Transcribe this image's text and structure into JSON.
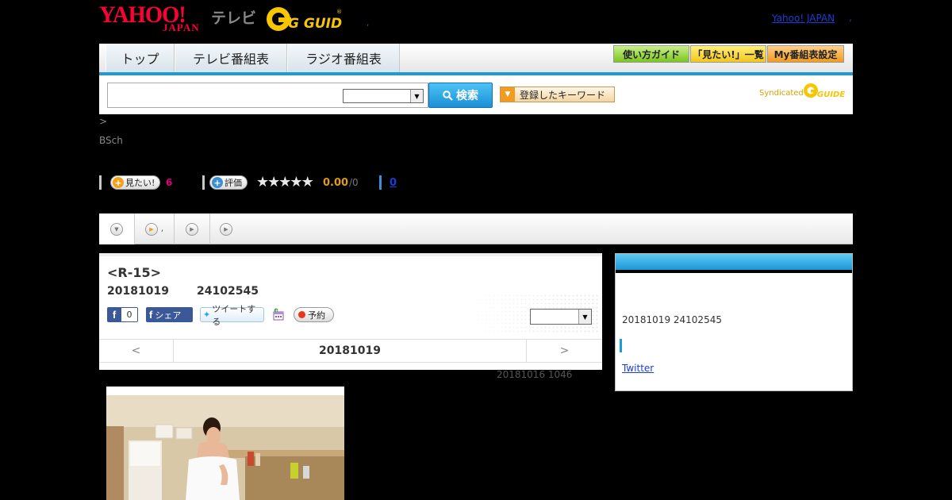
{
  "header": {
    "yahoo_logo": "YAHOO!",
    "yahoo_japan": "JAPAN",
    "tv_label": "テレビ",
    "gguide_logo": "G GUIDE",
    "yahoo_japan_link": "Yahoo! JAPAN",
    "link_separator": ",",
    "logo_dot": ","
  },
  "nav": {
    "tabs": [
      "トップ",
      "テレビ番組表",
      "ラジオ番組表"
    ],
    "buttons": [
      "使い方ガイド",
      "「見たい!」一覧",
      "My番組表設定"
    ],
    "accent": "#1e9ad6"
  },
  "search": {
    "input_value": "",
    "select_value": "",
    "search_label": "検索",
    "keyword_label": "登録したキーワード",
    "syndicated": "Syndicated"
  },
  "breadcrumb": ">",
  "channel": "BSch",
  "actions": {
    "mitai_label": "見たい!",
    "mitai_count": "6",
    "hyouka_label": "評価",
    "rating": "0.00",
    "rating_of": "/0",
    "review_count": "0",
    "star_rating": 0
  },
  "tabs": {
    "items": [
      "",
      ",",
      ""
    ]
  },
  "program": {
    "title": "<R-15>",
    "date": "20181019",
    "time": "24102545",
    "fb_like_count": "0",
    "fb_share": "シェア",
    "tweet": "ツイートする",
    "reserve": "予約",
    "select_value": ""
  },
  "date_nav": {
    "prev": "<",
    "date": "20181019",
    "next": ">"
  },
  "updated": "20181016  1046",
  "sidebar": {
    "date_time": "20181019  24102545",
    "twitter_link": "Twitter"
  }
}
